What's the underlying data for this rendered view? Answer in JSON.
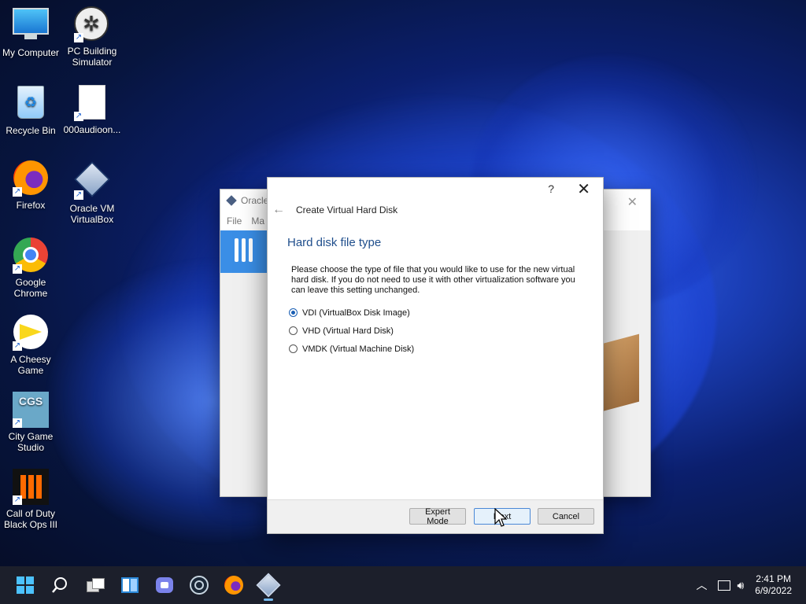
{
  "desktop": {
    "icons": [
      {
        "label": "My Computer",
        "icon": "monitor-icon"
      },
      {
        "label": "PC Building Simulator",
        "icon": "fan-icon"
      },
      {
        "label": "Recycle Bin",
        "icon": "recycle-bin-icon"
      },
      {
        "label": "000audioon...",
        "icon": "document-icon"
      },
      {
        "label": "Firefox",
        "icon": "firefox-icon"
      },
      {
        "label": "Oracle VM VirtualBox",
        "icon": "virtualbox-icon"
      },
      {
        "label": "Google Chrome",
        "icon": "chrome-icon"
      },
      {
        "label": "A Cheesy Game",
        "icon": "cheese-icon"
      },
      {
        "label": "City Game Studio",
        "icon": "cgs-icon"
      },
      {
        "label": "Call of Duty Black Ops III",
        "icon": "cod-icon"
      }
    ]
  },
  "back_window": {
    "title": "Oracle",
    "menu": [
      "File",
      "Ma"
    ]
  },
  "dialog": {
    "help": "?",
    "close": "✕",
    "back": "←",
    "header": "Create Virtual Hard Disk",
    "heading": "Hard disk file type",
    "description": "Please choose the type of file that you would like to use for the new virtual hard disk. If you do not need to use it with other virtualization software you can leave this setting unchanged.",
    "options": [
      {
        "label": "VDI (VirtualBox Disk Image)",
        "checked": true
      },
      {
        "label": "VHD (Virtual Hard Disk)",
        "checked": false
      },
      {
        "label": "VMDK (Virtual Machine Disk)",
        "checked": false
      }
    ],
    "buttons": {
      "expert": "Expert Mode",
      "next": "Next",
      "cancel": "Cancel"
    }
  },
  "taskbar": {
    "time": "2:41 PM",
    "date": "6/9/2022"
  }
}
